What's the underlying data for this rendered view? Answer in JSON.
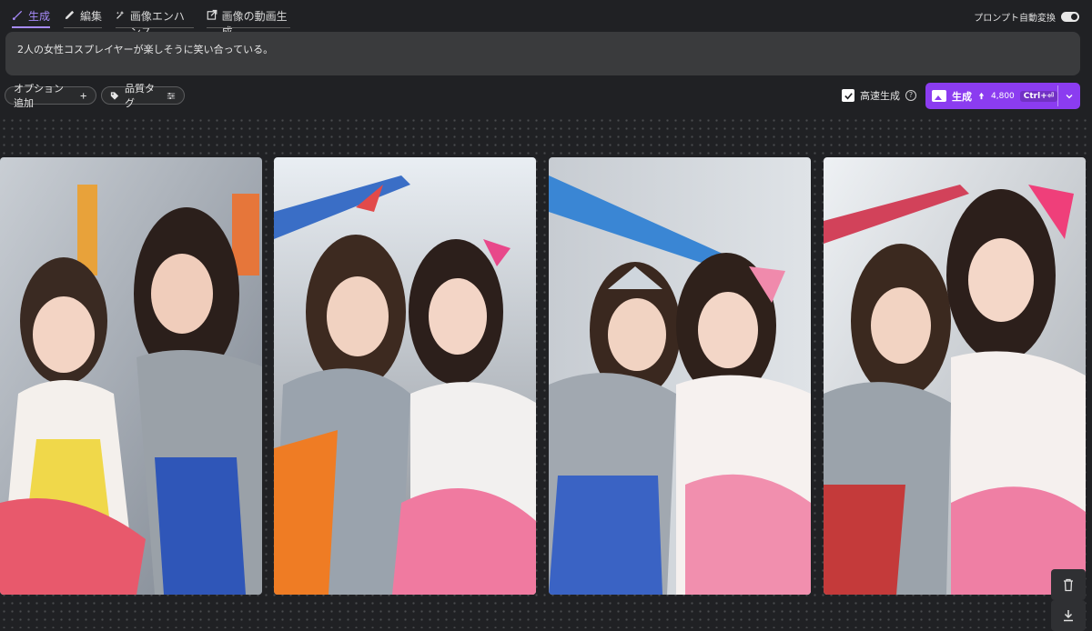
{
  "tabs": [
    {
      "label": "生成",
      "icon": "brush-icon",
      "active": true
    },
    {
      "label": "編集",
      "icon": "pencil-icon",
      "active": false
    },
    {
      "label": "画像エンハンス",
      "icon": "enhance-icon",
      "active": false
    },
    {
      "label": "画像の動画生成",
      "icon": "video-export-icon",
      "active": false
    }
  ],
  "prompt_convert": {
    "label": "プロンプト自動変換",
    "enabled": true
  },
  "prompt": {
    "text": "2人の女性コスプレイヤーが楽しそうに笑い合っている。"
  },
  "options": {
    "add_label": "オプション追加",
    "tag_label": "品質タグ"
  },
  "fast_generation": {
    "label": "高速生成",
    "checked": true
  },
  "generate": {
    "label": "生成",
    "credits": "4,800",
    "shortcut": "Ctrl+⏎"
  },
  "colors": {
    "accent": "#8b3cf0",
    "tab_active": "#a78bfa",
    "background": "#202124"
  },
  "images": [
    {
      "name": "generated-image-1"
    },
    {
      "name": "generated-image-2"
    },
    {
      "name": "generated-image-3"
    },
    {
      "name": "generated-image-4"
    }
  ],
  "side_actions": [
    {
      "icon": "trash-icon"
    },
    {
      "icon": "download-icon"
    }
  ]
}
